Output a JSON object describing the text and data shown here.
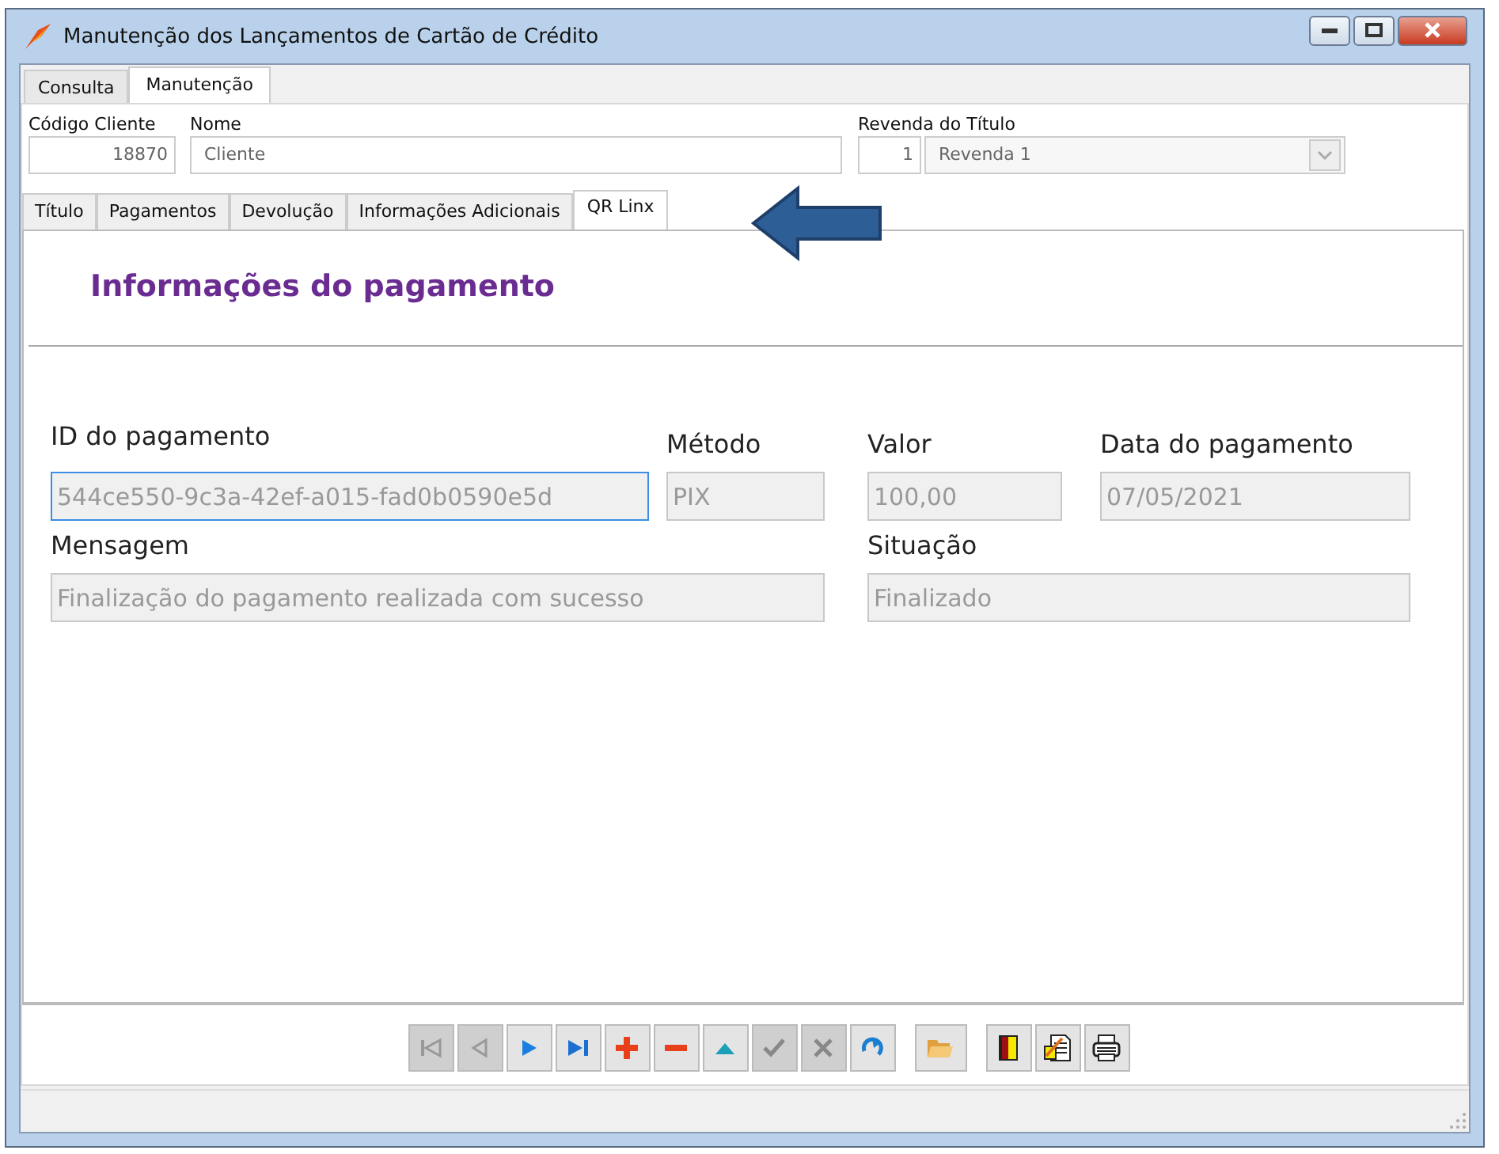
{
  "window": {
    "title": "Manutenção dos Lançamentos de Cartão de Crédito"
  },
  "tabs": [
    {
      "label": "Consulta",
      "selected": false
    },
    {
      "label": "Manutenção",
      "selected": true
    }
  ],
  "header_fields": {
    "codigo_cliente": {
      "label": "Código Cliente",
      "value": "18870"
    },
    "nome": {
      "label": "Nome",
      "value": "Cliente"
    },
    "revenda": {
      "label": "Revenda do Título",
      "code": "1",
      "value": "Revenda 1"
    }
  },
  "inner_tabs": [
    {
      "label": "Título",
      "selected": false
    },
    {
      "label": "Pagamentos",
      "selected": false
    },
    {
      "label": "Devolução",
      "selected": false
    },
    {
      "label": "Informações Adicionais",
      "selected": false
    },
    {
      "label": "QR Linx",
      "selected": true
    }
  ],
  "panel": {
    "heading": "Informações do pagamento",
    "fields": [
      {
        "label": "ID do pagamento",
        "value": "544ce550-9c3a-42ef-a015-fad0b0590e5d",
        "focused": true
      },
      {
        "label": "Método",
        "value": "PIX",
        "focused": false
      },
      {
        "label": "Valor",
        "value": "100,00",
        "focused": false
      },
      {
        "label": "Data do pagamento",
        "value": "07/05/2021",
        "focused": false
      },
      {
        "label": "Mensagem",
        "value": "Finalização do pagamento realizada com sucesso",
        "focused": false
      },
      {
        "label": "Situação",
        "value": "Finalizado",
        "focused": false
      }
    ]
  },
  "toolbar": [
    {
      "kind": "first",
      "disabled": true
    },
    {
      "kind": "prev",
      "disabled": true
    },
    {
      "kind": "next",
      "disabled": false
    },
    {
      "kind": "last",
      "disabled": false
    },
    {
      "kind": "add",
      "disabled": false
    },
    {
      "kind": "remove",
      "disabled": false
    },
    {
      "kind": "edit",
      "disabled": false
    },
    {
      "kind": "confirm",
      "disabled": true
    },
    {
      "kind": "cancel",
      "disabled": true
    },
    {
      "kind": "refresh",
      "disabled": false
    },
    {
      "kind": "open",
      "disabled": false
    },
    {
      "kind": "exit",
      "disabled": false
    },
    {
      "kind": "report",
      "disabled": false
    },
    {
      "kind": "print",
      "disabled": false
    }
  ]
}
